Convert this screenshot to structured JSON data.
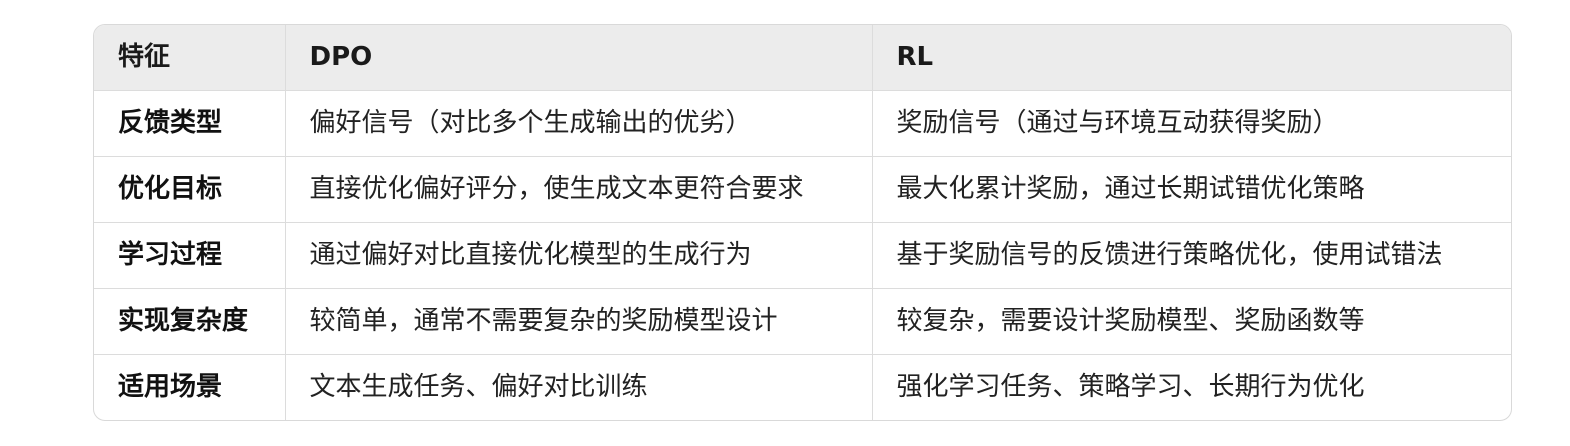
{
  "table": {
    "headers": [
      "特征",
      "DPO",
      "RL"
    ],
    "rows": [
      [
        "反馈类型",
        "偏好信号（对比多个生成输出的优劣）",
        "奖励信号（通过与环境互动获得奖励）"
      ],
      [
        "优化目标",
        "直接优化偏好评分，使生成文本更符合要求",
        "最大化累计奖励，通过长期试错优化策略"
      ],
      [
        "学习过程",
        "通过偏好对比直接优化模型的生成行为",
        "基于奖励信号的反馈进行策略优化，使用试错法"
      ],
      [
        "实现复杂度",
        "较简单，通常不需要复杂的奖励模型设计",
        "较复杂，需要设计奖励模型、奖励函数等"
      ],
      [
        "适用场景",
        "文本生成任务、偏好对比训练",
        "强化学习任务、策略学习、长期行为优化"
      ]
    ]
  }
}
